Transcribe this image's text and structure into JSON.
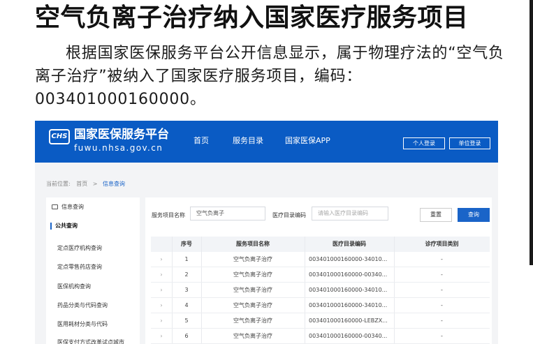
{
  "article": {
    "headline": "空气负离子治疗纳入国家医疗服务项目",
    "body": "根据国家医保服务平台公开信息显示，属于物理疗法的“空气负离子治疗”被纳入了国家医疗服务项目，编码：003401000160000。"
  },
  "site": {
    "badge": "CHS",
    "title": "国家医保服务平台",
    "subtitle": "fuwu.nhsa.gov.cn",
    "nav": [
      "首页",
      "服务目录",
      "国家医保APP"
    ],
    "personal_login": "个人登录",
    "org_login": "单位登录"
  },
  "breadcrumb": {
    "prefix": "当前位置:",
    "home": "首页",
    "separator": ">",
    "current": "信息查询"
  },
  "sidebar": {
    "header": "信息查询",
    "group": "公共查询",
    "items": [
      "定点医疗机构查询",
      "定点零售药店查询",
      "医保机构查询",
      "药品分类与代码查询",
      "医用耗材分类与代码",
      "医保支付方式改革试点城市"
    ]
  },
  "search": {
    "name_label": "服务项目名称",
    "name_value": "空气负离子",
    "code_label": "医疗目录编码",
    "code_placeholder": "请输入医疗目录编码",
    "reset": "重置",
    "query": "查询"
  },
  "table": {
    "headers": [
      "",
      "序号",
      "服务项目名称",
      "医疗目录编码",
      "诊疗项目类别"
    ],
    "rows": [
      {
        "expand": "›",
        "no": "1",
        "name": "空气负离子治疗",
        "code": "003401000160000-34010...",
        "category": "-"
      },
      {
        "expand": "›",
        "no": "2",
        "name": "空气负离子治疗",
        "code": "003401000160000-00340...",
        "category": "-"
      },
      {
        "expand": "›",
        "no": "3",
        "name": "空气负离子治疗",
        "code": "003401000160000-34010...",
        "category": "-"
      },
      {
        "expand": "›",
        "no": "4",
        "name": "空气负离子治疗",
        "code": "003401000160000-34010...",
        "category": "-"
      },
      {
        "expand": "›",
        "no": "5",
        "name": "空气负离子治疗",
        "code": "003401000160000-LEBZX...",
        "category": "-"
      },
      {
        "expand": "›",
        "no": "6",
        "name": "空气负离子治疗",
        "code": "003401000160000-00340...",
        "category": "-"
      }
    ]
  },
  "colors": {
    "brand_blue": "#0a5bc4",
    "link_blue": "#1a64c8"
  }
}
